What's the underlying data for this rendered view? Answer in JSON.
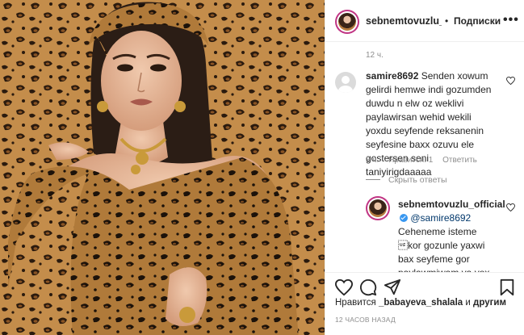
{
  "header": {
    "username": "sebnemtovuzlu_official",
    "separator": "•",
    "follow_label": "Подписки",
    "more_icon": "more-horizontal-icon"
  },
  "comments": {
    "post_time": "12 ч.",
    "comment": {
      "username": "samire8692",
      "text": "Senden xowum gelirdi hemwe indi gozumden duwdu n elw oz weklivi paylawirsan wehid wekili yoxdu seyfende reksanenin seyfesine baxx ozuvu ele gostersen seni taniyirigdaaaaa",
      "time": "3 ч.",
      "likes": "Нравится: 1",
      "reply_label": "Ответить",
      "hide_replies": "Скрыть ответы"
    },
    "reply": {
      "username": "sebnemtovuzlu_official",
      "mention": "@samire8692",
      "text": "Ceheneme isteme \u001fkor gozunle yaxwi bax seyfeme gor paylawmiwam ya yox acki taxz"
    }
  },
  "actions": {
    "icons": [
      "heart-icon",
      "comment-icon",
      "share-icon",
      "bookmark-icon"
    ],
    "likes_prefix": "Нравится",
    "likes_user": "_babayeva_shalala",
    "likes_conj": "и",
    "likes_others": "другим",
    "time": "12 ЧАСОВ НАЗАД"
  },
  "colors": {
    "accent": "#c13584",
    "verified": "#3897f0",
    "muted": "#8e8e8e",
    "mention": "#00376b"
  }
}
